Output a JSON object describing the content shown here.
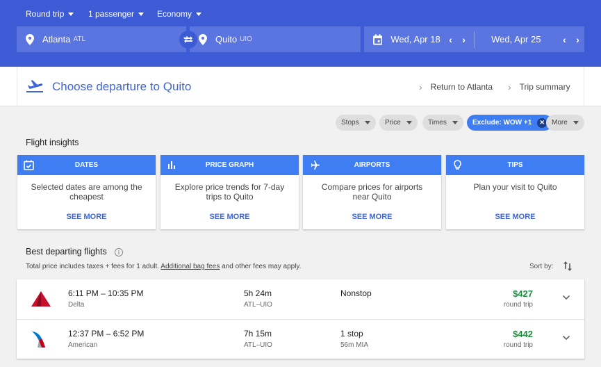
{
  "header": {
    "trip_type": "Round trip",
    "passengers": "1 passenger",
    "cabin": "Economy",
    "origin": {
      "city": "Atlanta",
      "code": "ATL"
    },
    "destination": {
      "city": "Quito",
      "code": "UIO"
    },
    "depart_date": "Wed, Apr 18",
    "return_date": "Wed, Apr 25",
    "prev_icon": "‹",
    "next_icon": "›"
  },
  "steps": {
    "current": "Choose departure to Quito",
    "next": "Return to Atlanta",
    "summary": "Trip summary"
  },
  "filters": {
    "stops": "Stops",
    "price": "Price",
    "times": "Times",
    "exclude": "Exclude: WOW +1",
    "more": "More"
  },
  "insights": {
    "heading": "Flight insights",
    "cards": [
      {
        "title": "DATES",
        "text": "Selected dates are among the cheapest",
        "link": "SEE MORE"
      },
      {
        "title": "PRICE GRAPH",
        "text": "Explore price trends for 7-day trips to Quito",
        "link": "SEE MORE"
      },
      {
        "title": "AIRPORTS",
        "text": "Compare prices for airports near Quito",
        "link": "SEE MORE"
      },
      {
        "title": "TIPS",
        "text": "Plan your visit to Quito",
        "link": "SEE MORE"
      }
    ]
  },
  "best": {
    "heading": "Best departing flights",
    "note_before": "Total price includes taxes + fees for 1 adult. ",
    "note_link": "Additional bag fees",
    "note_after": " and other fees may apply.",
    "sort_label": "Sort by:"
  },
  "flights": [
    {
      "times": "6:11 PM – 10:35 PM",
      "airline": "Delta",
      "duration": "5h 24m",
      "route": "ATL–UIO",
      "stops": "Nonstop",
      "stop_detail": "",
      "price": "$427",
      "price_type": "round trip"
    },
    {
      "times": "12:37 PM – 6:52 PM",
      "airline": "American",
      "duration": "7h 15m",
      "route": "ATL–UIO",
      "stops": "1 stop",
      "stop_detail": "56m MIA",
      "price": "$442",
      "price_type": "round trip"
    }
  ],
  "colors": {
    "header_bg": "#3e5bd6",
    "accent": "#3e7ef2",
    "price_green": "#1e8e3e",
    "delta_red": "#c8102e"
  }
}
